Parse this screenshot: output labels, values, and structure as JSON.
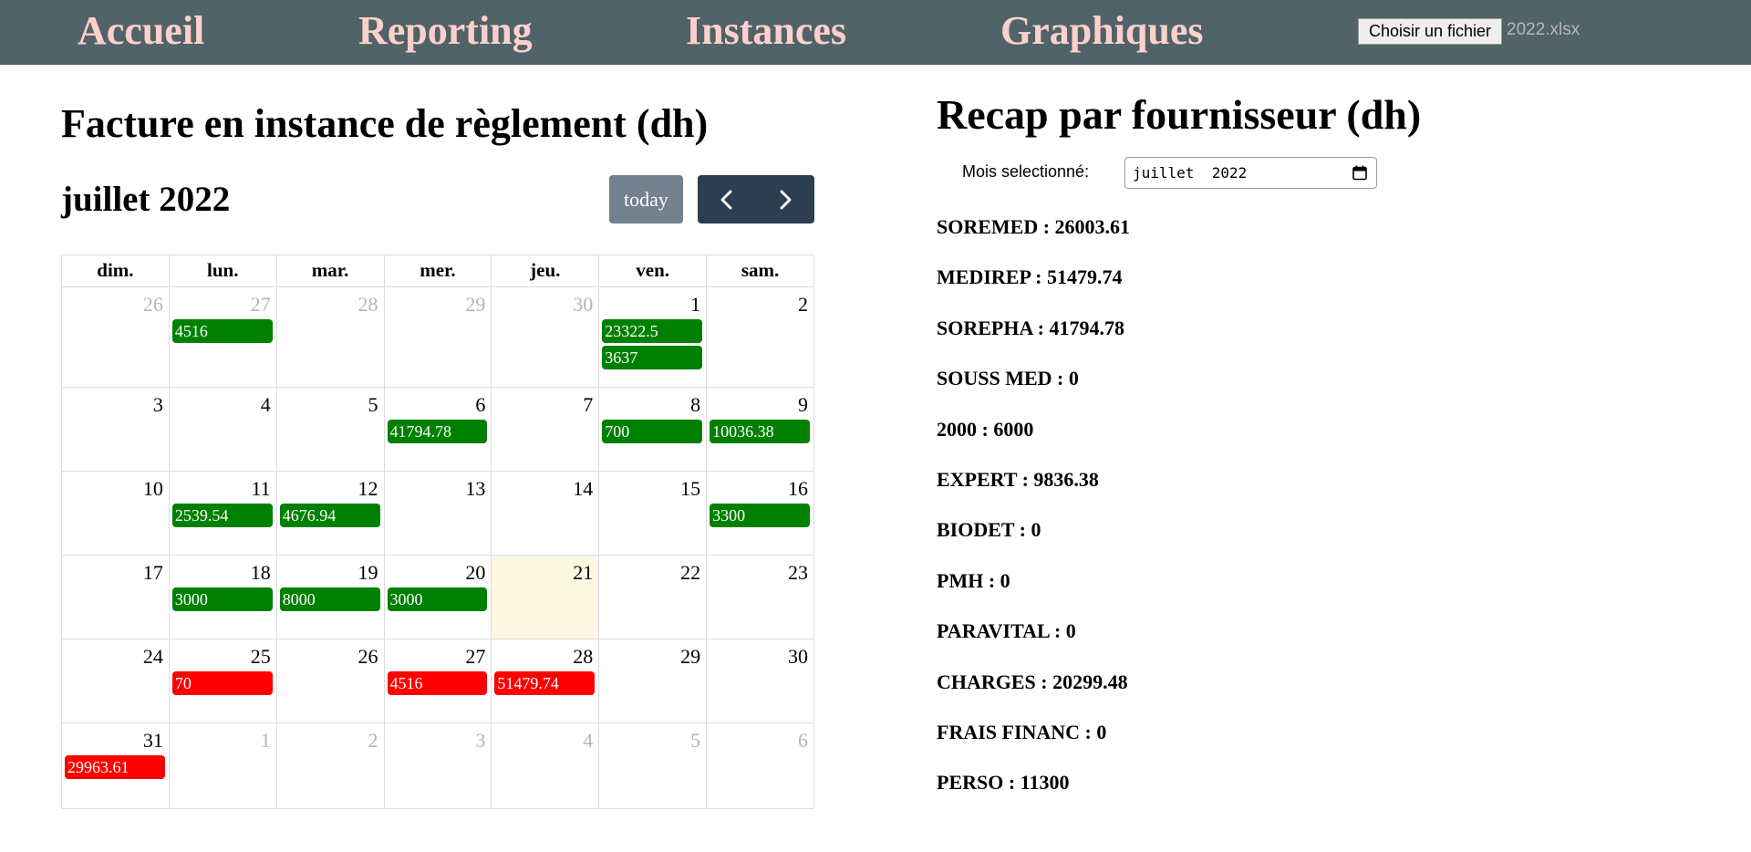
{
  "nav": {
    "links": [
      "Accueil",
      "Reporting",
      "Instances",
      "Graphiques"
    ],
    "file_button": "Choisir un fichier",
    "file_name": "2022.xlsx"
  },
  "calendar": {
    "title": "Facture en instance de règlement (dh)",
    "month_label": "juillet 2022",
    "today_label": "today",
    "weekdays": [
      "dim.",
      "lun.",
      "mar.",
      "mer.",
      "jeu.",
      "ven.",
      "sam."
    ],
    "weeks": [
      [
        {
          "d": "26",
          "o": true
        },
        {
          "d": "27",
          "o": true,
          "ev": [
            {
              "t": "4516",
              "c": "green"
            }
          ]
        },
        {
          "d": "28",
          "o": true
        },
        {
          "d": "29",
          "o": true
        },
        {
          "d": "30",
          "o": true
        },
        {
          "d": "1",
          "ev": [
            {
              "t": "23322.5",
              "c": "green"
            },
            {
              "t": "3637",
              "c": "green"
            }
          ]
        },
        {
          "d": "2"
        }
      ],
      [
        {
          "d": "3"
        },
        {
          "d": "4"
        },
        {
          "d": "5"
        },
        {
          "d": "6",
          "ev": [
            {
              "t": "41794.78",
              "c": "green"
            }
          ]
        },
        {
          "d": "7"
        },
        {
          "d": "8",
          "ev": [
            {
              "t": "700",
              "c": "green"
            }
          ]
        },
        {
          "d": "9",
          "ev": [
            {
              "t": "10036.38",
              "c": "green"
            }
          ]
        }
      ],
      [
        {
          "d": "10"
        },
        {
          "d": "11",
          "ev": [
            {
              "t": "2539.54",
              "c": "green"
            }
          ]
        },
        {
          "d": "12",
          "ev": [
            {
              "t": "4676.94",
              "c": "green"
            }
          ]
        },
        {
          "d": "13"
        },
        {
          "d": "14"
        },
        {
          "d": "15"
        },
        {
          "d": "16",
          "ev": [
            {
              "t": "3300",
              "c": "green"
            }
          ]
        }
      ],
      [
        {
          "d": "17"
        },
        {
          "d": "18",
          "ev": [
            {
              "t": "3000",
              "c": "green"
            }
          ]
        },
        {
          "d": "19",
          "ev": [
            {
              "t": "8000",
              "c": "green"
            }
          ]
        },
        {
          "d": "20",
          "ev": [
            {
              "t": "3000",
              "c": "green"
            }
          ]
        },
        {
          "d": "21",
          "today": true
        },
        {
          "d": "22"
        },
        {
          "d": "23"
        }
      ],
      [
        {
          "d": "24"
        },
        {
          "d": "25",
          "ev": [
            {
              "t": "70",
              "c": "red"
            }
          ]
        },
        {
          "d": "26"
        },
        {
          "d": "27",
          "ev": [
            {
              "t": "4516",
              "c": "red"
            }
          ]
        },
        {
          "d": "28",
          "ev": [
            {
              "t": "51479.74",
              "c": "red"
            }
          ]
        },
        {
          "d": "29"
        },
        {
          "d": "30"
        }
      ],
      [
        {
          "d": "31",
          "ev": [
            {
              "t": "29963.61",
              "c": "red"
            }
          ]
        },
        {
          "d": "1",
          "o": true
        },
        {
          "d": "2",
          "o": true
        },
        {
          "d": "3",
          "o": true
        },
        {
          "d": "4",
          "o": true
        },
        {
          "d": "5",
          "o": true
        },
        {
          "d": "6",
          "o": true
        }
      ]
    ]
  },
  "recap": {
    "title": "Recap par fournisseur (dh)",
    "mois_label": "Mois selectionné:",
    "mois_value": "juillet  2022",
    "items": [
      "SOREMED : 26003.61",
      "MEDIREP : 51479.74",
      "SOREPHA : 41794.78",
      "SOUSS MED : 0",
      "2000 : 6000",
      "EXPERT : 9836.38",
      "BIODET : 0",
      "PMH : 0",
      "PARAVITAL : 0",
      "CHARGES : 20299.48",
      "FRAIS FINANC : 0",
      "PERSO : 11300"
    ]
  },
  "colors": {
    "navbar": "#4f6368",
    "nav_link": "#ffd0cb",
    "event_green": "#008000",
    "event_red": "#ff0000",
    "today_highlight": "#fdf8e1"
  }
}
